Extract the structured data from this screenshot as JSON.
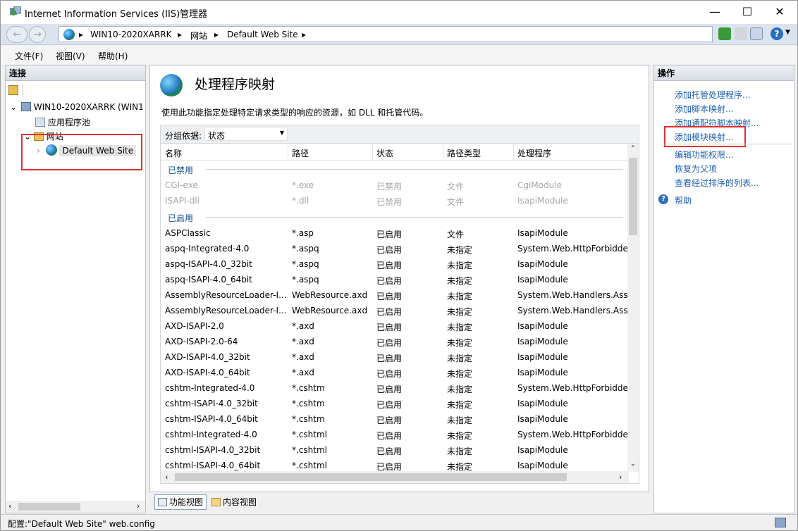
{
  "window": {
    "title": "Internet Information Services (IIS)管理器",
    "minimize": "—",
    "maximize": "☐",
    "close": "✕"
  },
  "address": {
    "back": "←",
    "forward": "→",
    "crumbs": [
      "WIN10-2020XARRK",
      "网站",
      "Default Web Site"
    ],
    "sep": "▸"
  },
  "menu": {
    "file": "文件(F)",
    "view": "视图(V)",
    "help": "帮助(H)"
  },
  "left": {
    "header": "连接",
    "tree": {
      "server": "WIN10-2020XARRK (WIN1",
      "app_pools": "应用程序池",
      "sites": "网站",
      "default_site": "Default Web Site"
    }
  },
  "center": {
    "title": "处理程序映射",
    "description": "使用此功能指定处理特定请求类型的响应的资源，如 DLL 和托管代码。",
    "group_by_label": "分组依据:",
    "group_by_value": "状态",
    "columns": [
      "名称",
      "路径",
      "状态",
      "路径类型",
      "处理程序"
    ],
    "groups": {
      "disabled": "已禁用",
      "enabled": "已启用"
    },
    "disabled_rows": [
      [
        "CGI-exe",
        "*.exe",
        "已禁用",
        "文件",
        "CgiModule"
      ],
      [
        "ISAPI-dll",
        "*.dll",
        "已禁用",
        "文件",
        "IsapiModule"
      ]
    ],
    "enabled_rows": [
      [
        "ASPClassic",
        "*.asp",
        "已启用",
        "文件",
        "IsapiModule"
      ],
      [
        "aspq-Integrated-4.0",
        "*.aspq",
        "已启用",
        "未指定",
        "System.Web.HttpForbidde.."
      ],
      [
        "aspq-ISAPI-4.0_32bit",
        "*.aspq",
        "已启用",
        "未指定",
        "IsapiModule"
      ],
      [
        "aspq-ISAPI-4.0_64bit",
        "*.aspq",
        "已启用",
        "未指定",
        "IsapiModule"
      ],
      [
        "AssemblyResourceLoader-I...",
        "WebResource.axd",
        "已启用",
        "未指定",
        "System.Web.Handlers.Asse"
      ],
      [
        "AssemblyResourceLoader-I...",
        "WebResource.axd",
        "已启用",
        "未指定",
        "System.Web.Handlers.Asse"
      ],
      [
        "AXD-ISAPI-2.0",
        "*.axd",
        "已启用",
        "未指定",
        "IsapiModule"
      ],
      [
        "AXD-ISAPI-2.0-64",
        "*.axd",
        "已启用",
        "未指定",
        "IsapiModule"
      ],
      [
        "AXD-ISAPI-4.0_32bit",
        "*.axd",
        "已启用",
        "未指定",
        "IsapiModule"
      ],
      [
        "AXD-ISAPI-4.0_64bit",
        "*.axd",
        "已启用",
        "未指定",
        "IsapiModule"
      ],
      [
        "cshtm-Integrated-4.0",
        "*.cshtm",
        "已启用",
        "未指定",
        "System.Web.HttpForbidde.."
      ],
      [
        "cshtm-ISAPI-4.0_32bit",
        "*.cshtm",
        "已启用",
        "未指定",
        "IsapiModule"
      ],
      [
        "cshtm-ISAPI-4.0_64bit",
        "*.cshtm",
        "已启用",
        "未指定",
        "IsapiModule"
      ],
      [
        "cshtml-Integrated-4.0",
        "*.cshtml",
        "已启用",
        "未指定",
        "System.Web.HttpForbidde.."
      ],
      [
        "cshtml-ISAPI-4.0_32bit",
        "*.cshtml",
        "已启用",
        "未指定",
        "IsapiModule"
      ],
      [
        "cshtml-ISAPI-4.0_64bit",
        "*.cshtml",
        "已启用",
        "未指定",
        "IsapiModule"
      ]
    ],
    "tabs": {
      "features": "功能视图",
      "content": "内容视图"
    }
  },
  "actions": {
    "header": "操作",
    "items": [
      "添加托管处理程序...",
      "添加脚本映射...",
      "添加通配符脚本映射...",
      "添加模块映射..."
    ],
    "items2": [
      "编辑功能权限...",
      "恢复为父项",
      "查看经过排序的列表..."
    ],
    "help": "帮助"
  },
  "status": {
    "text": "配置:\"Default Web Site\" web.config"
  },
  "colors": {
    "link": "#1f5fb4",
    "highlight": "#e03030",
    "group": "#1d4f91"
  }
}
